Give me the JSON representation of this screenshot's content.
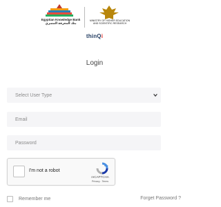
{
  "logos": {
    "ekb_name_en": "Egyptian Knowledge Bank",
    "ekb_name_ar": "بنك المعرفة المصري",
    "ministry_name": "MINISTRY OF HIGHER EDUCATION AND SCIENTIFIC RESEARCH"
  },
  "brand": {
    "main": "thinQ",
    "accent": "i"
  },
  "login": {
    "title": "Login",
    "user_type_placeholder": "Select User Type",
    "email_placeholder": "Email",
    "password_placeholder": "Password"
  },
  "captcha": {
    "label": "I'm not a robot",
    "brand": "reCAPTCHA",
    "links": "Privacy - Terms"
  },
  "footer": {
    "remember_label": "Remember me",
    "forgot_label": "Forget Password ?"
  },
  "colors": {
    "brand_dark": "#1f3a5f",
    "brand_accent": "#e3342f",
    "field_bg": "#f5f5f7"
  }
}
